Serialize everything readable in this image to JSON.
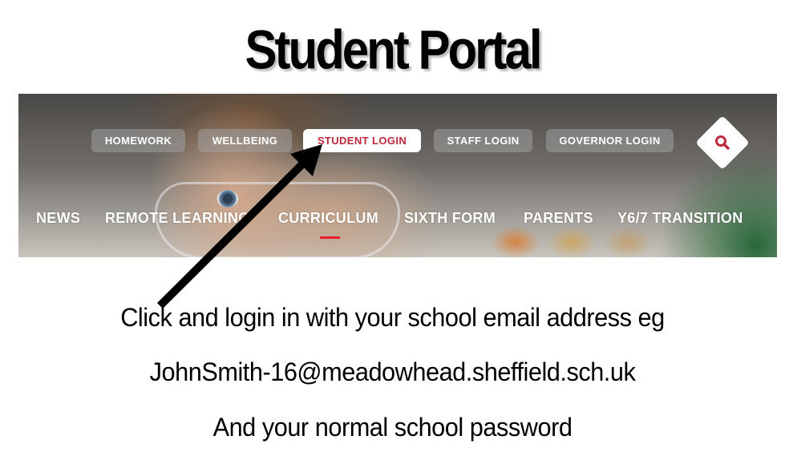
{
  "title": "Student Portal",
  "header_nav": {
    "buttons": [
      {
        "label": "HOMEWORK",
        "active": false
      },
      {
        "label": "WELLBEING",
        "active": false
      },
      {
        "label": "STUDENT LOGIN",
        "active": true
      },
      {
        "label": "STAFF LOGIN",
        "active": false
      },
      {
        "label": "GOVERNOR LOGIN",
        "active": false
      }
    ],
    "search_icon": "search-icon"
  },
  "main_nav": {
    "items": [
      {
        "label": "NEWS"
      },
      {
        "label": "REMOTE LEARNING"
      },
      {
        "label": "CURRICULUM",
        "current": true
      },
      {
        "label": "SIXTH FORM"
      },
      {
        "label": "PARENTS"
      },
      {
        "label": "Y6/7 TRANSITION"
      }
    ]
  },
  "annotation": {
    "arrow_icon": "arrow-pointer-icon",
    "arrow_target": "STUDENT LOGIN"
  },
  "instructions": {
    "line1": "Click and login in with your school email address eg",
    "line2": "JohnSmith-16@meadowhead.sheffield.sch.uk",
    "line3": "And your normal school password"
  },
  "colors": {
    "accent": "#c0283b",
    "underline": "#e8202e",
    "pill_bg": "#a0a0a0"
  }
}
